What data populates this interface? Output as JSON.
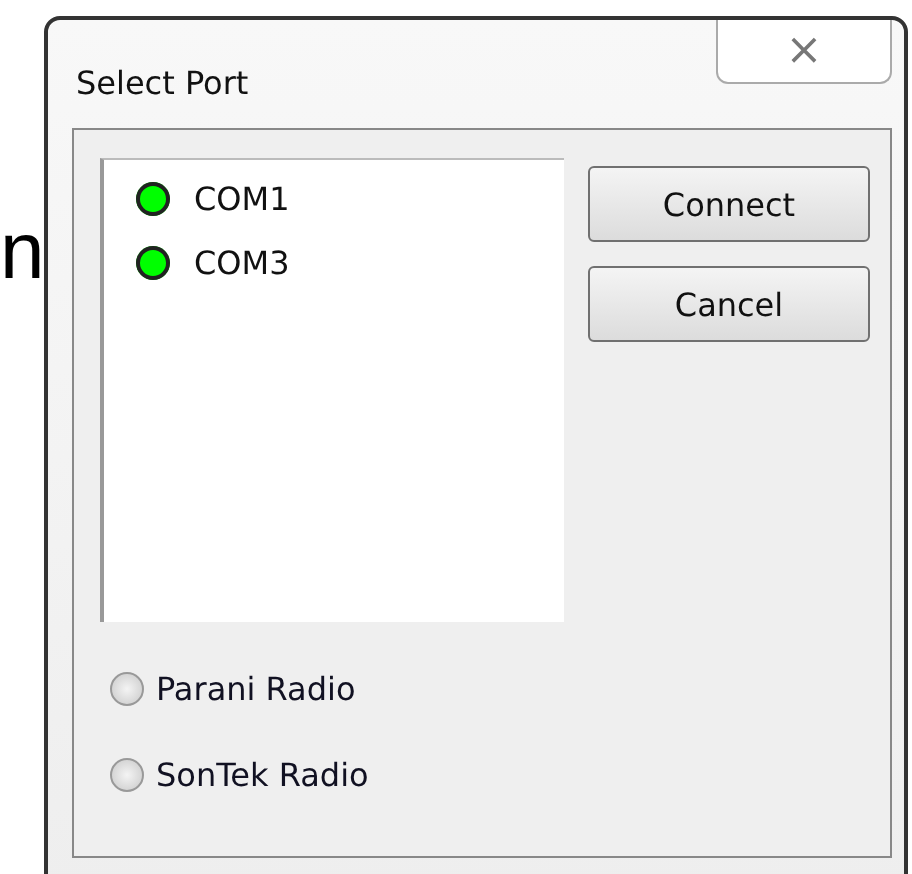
{
  "background_text": "n",
  "window": {
    "title": "Select Port",
    "close": "×"
  },
  "ports": [
    {
      "name": "COM1",
      "color": "#00ff00"
    },
    {
      "name": "COM3",
      "color": "#00ff00"
    }
  ],
  "buttons": [
    "Connect",
    "Cancel"
  ],
  "radios": [
    {
      "label": "Parani Radio",
      "selected": false
    },
    {
      "label": "SonTek Radio",
      "selected": false
    }
  ]
}
